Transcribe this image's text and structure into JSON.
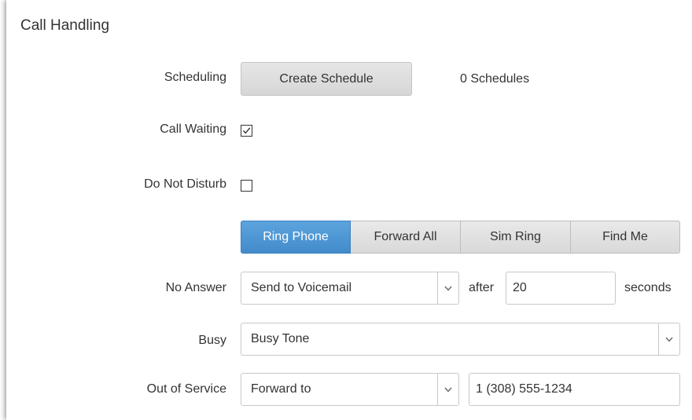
{
  "section": {
    "title": "Call Handling"
  },
  "scheduling": {
    "label": "Scheduling",
    "button_label": "Create Schedule",
    "count_text": "0 Schedules"
  },
  "call_waiting": {
    "label": "Call Waiting",
    "checked": true
  },
  "do_not_disturb": {
    "label": "Do Not Disturb",
    "checked": false
  },
  "ring_mode": {
    "options": [
      "Ring Phone",
      "Forward All",
      "Sim Ring",
      "Find Me"
    ],
    "selected": "Ring Phone"
  },
  "no_answer": {
    "label": "No Answer",
    "action": "Send to Voicemail",
    "after_label": "after",
    "seconds_value": "20",
    "seconds_label": "seconds"
  },
  "busy": {
    "label": "Busy",
    "action": "Busy Tone"
  },
  "out_of_service": {
    "label": "Out of Service",
    "action": "Forward to",
    "number": "1 (308) 555-1234"
  },
  "colors": {
    "active_segment": "#428bca",
    "button_bg": "#dcdcdc"
  },
  "icons": {
    "dropdown": "chevron-down-icon",
    "check": "checkmark-icon"
  }
}
